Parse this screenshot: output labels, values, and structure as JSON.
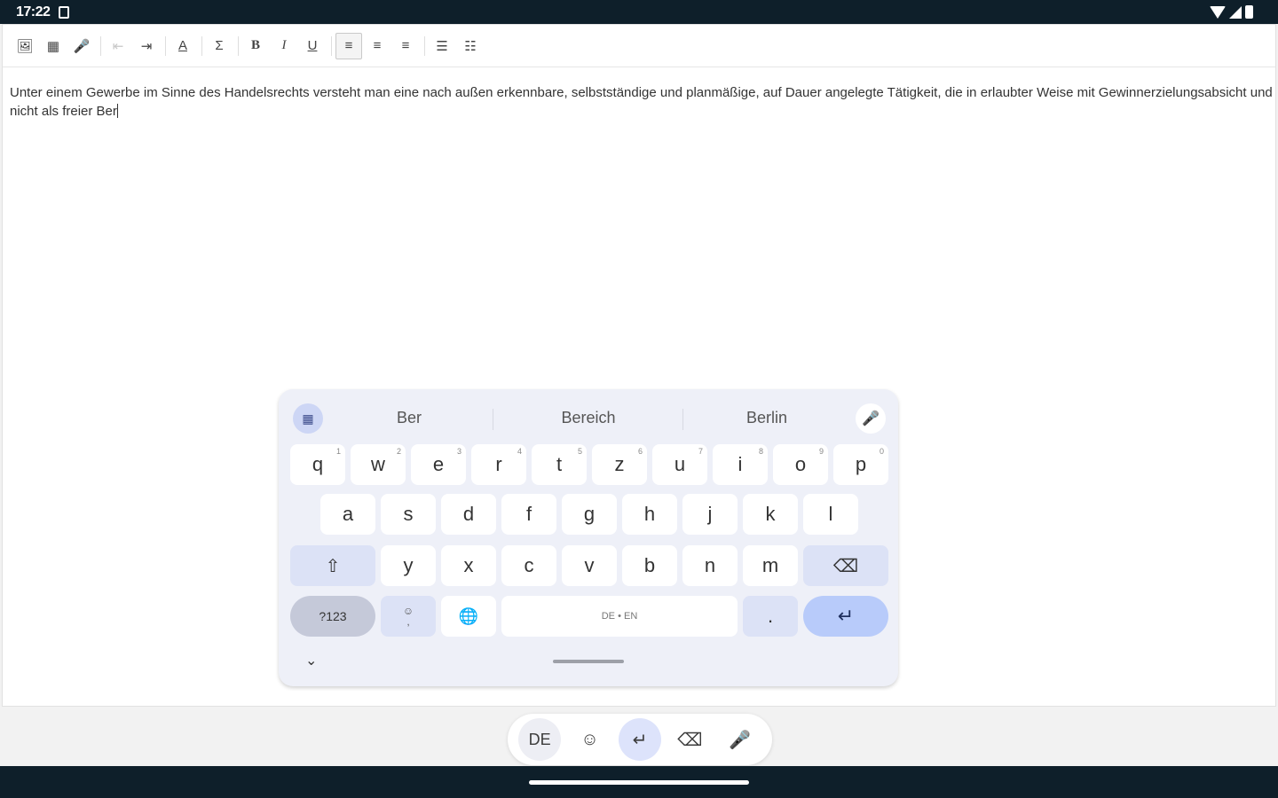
{
  "status_bar": {
    "time": "17:22"
  },
  "document": {
    "text": "Unter einem Gewerbe im Sinne des Handelsrechts versteht man eine nach außen erkennbare, selbstständige und planmäßige, auf Dauer angelegte Tätigkeit, die in erlaubter Weise mit Gewinnerzielungsabsicht und nicht als freier Ber"
  },
  "toolbar": {
    "image": "🖼",
    "media": "▦",
    "audio": "🎤",
    "indent_decrease": "⇤",
    "indent_increase": "⇥",
    "text_color": "A",
    "formula": "Σ",
    "bold": "B",
    "italic": "I",
    "underline": "U",
    "align_left": "≡",
    "align_center": "≡",
    "align_right": "≡",
    "ordered_list": "☰",
    "bullet_list": "☷"
  },
  "keyboard": {
    "suggestions": [
      "Ber",
      "Bereich",
      "Berlin"
    ],
    "row1": [
      {
        "key": "q",
        "hint": "1"
      },
      {
        "key": "w",
        "hint": "2"
      },
      {
        "key": "e",
        "hint": "3"
      },
      {
        "key": "r",
        "hint": "4"
      },
      {
        "key": "t",
        "hint": "5"
      },
      {
        "key": "z",
        "hint": "6"
      },
      {
        "key": "u",
        "hint": "7"
      },
      {
        "key": "i",
        "hint": "8"
      },
      {
        "key": "o",
        "hint": "9"
      },
      {
        "key": "p",
        "hint": "0"
      }
    ],
    "row2": [
      "a",
      "s",
      "d",
      "f",
      "g",
      "h",
      "j",
      "k",
      "l"
    ],
    "row3": [
      "y",
      "x",
      "c",
      "v",
      "b",
      "n",
      "m"
    ],
    "shift": "⇧",
    "backspace": "⌫",
    "symbols": "?123",
    "comma_top": "☺",
    "comma": ",",
    "globe": "🌐",
    "space_label": "DE • EN",
    "period": ".",
    "enter": "↵",
    "collapse": "⌄"
  },
  "floating_bar": {
    "lang": "DE",
    "emoji": "☺",
    "enter": "↵",
    "delete": "⌫",
    "mic": "🎤"
  }
}
